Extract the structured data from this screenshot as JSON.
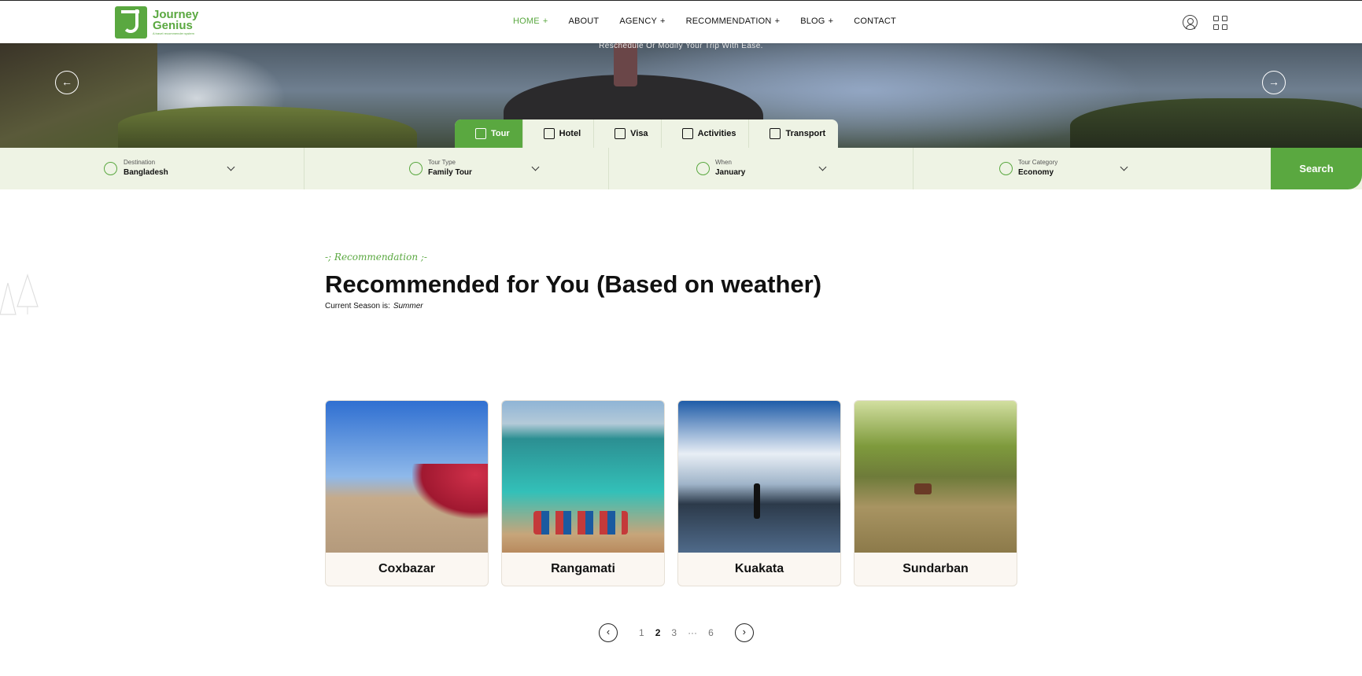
{
  "brand": {
    "name_line1": "Journey",
    "name_line2": "Genius",
    "tagline": "A travel recommender system",
    "color": "#5aa840"
  },
  "nav": {
    "items": [
      {
        "label": "HOME",
        "has_submenu": true,
        "active": true
      },
      {
        "label": "ABOUT",
        "has_submenu": false
      },
      {
        "label": "AGENCY",
        "has_submenu": true
      },
      {
        "label": "RECOMMENDATION",
        "has_submenu": true
      },
      {
        "label": "BLOG",
        "has_submenu": true
      },
      {
        "label": "CONTACT",
        "has_submenu": false
      }
    ],
    "plus_glyph": "+",
    "icons": [
      "user-icon",
      "grid-icon"
    ]
  },
  "hero": {
    "caption": "Reschedule Or Modify Your Trip With Ease.",
    "prev_glyph": "←",
    "next_glyph": "→"
  },
  "tabs": [
    {
      "label": "Tour",
      "icon": "tour-icon",
      "active": true
    },
    {
      "label": "Hotel",
      "icon": "hotel-icon"
    },
    {
      "label": "Visa",
      "icon": "visa-icon"
    },
    {
      "label": "Activities",
      "icon": "activities-icon"
    },
    {
      "label": "Transport",
      "icon": "transport-icon"
    }
  ],
  "search": {
    "fields": [
      {
        "label": "Destination",
        "value": "Bangladesh",
        "icon": "location-pin-icon"
      },
      {
        "label": "Tour Type",
        "value": "Family Tour",
        "icon": "tour-type-icon"
      },
      {
        "label": "When",
        "value": "January",
        "icon": "clock-icon"
      },
      {
        "label": "Tour Category",
        "value": "Economy",
        "icon": "tour-category-icon"
      }
    ],
    "button_label": "Search"
  },
  "section": {
    "eyebrow": "Recommendation",
    "title": "Recommended for You (Based on weather)",
    "season_label": "Current Season is:",
    "season_value": "Summer"
  },
  "cards": [
    {
      "name": "Coxbazar"
    },
    {
      "name": "Rangamati"
    },
    {
      "name": "Kuakata"
    },
    {
      "name": "Sundarban"
    }
  ],
  "pagination": {
    "prev_glyph": "‹",
    "next_glyph": "›",
    "pages": [
      "1",
      "2",
      "3",
      "···",
      "6"
    ],
    "current": "2"
  }
}
